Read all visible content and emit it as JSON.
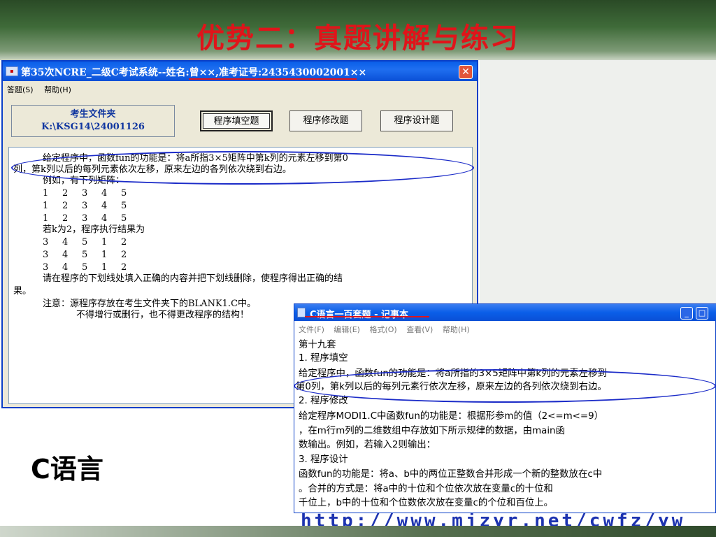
{
  "slide": {
    "title": "优势二：真题讲解与练习",
    "subject_label": "C语言",
    "footer_url": "http://www.mjzyr.net/cwfz/yw"
  },
  "exam_window": {
    "title": "第35次NCRE_二级C考试系统--姓名:曾××,准考证号:2435430002001××",
    "menu": [
      "答题(S)",
      "帮助(H)"
    ],
    "folder_label": "考生文件夹",
    "folder_path": "K:\\KSG14\\24001126",
    "tabs": [
      "程序填空题",
      "程序修改题",
      "程序设计题"
    ],
    "active_tab": "程序填空题",
    "content": {
      "line1": "给定程序中，函数fun的功能是：将a所指3×5矩阵中第k列的元素左移到第0",
      "line2": "列，第k列以后的每列元素依次左移，原来左边的各列依次绕到右边。",
      "line3": "例如，有下列矩阵：",
      "matrix_before": [
        [
          "1",
          "2",
          "3",
          "4",
          "5"
        ],
        [
          "1",
          "2",
          "3",
          "4",
          "5"
        ],
        [
          "1",
          "2",
          "3",
          "4",
          "5"
        ]
      ],
      "line4": "若k为2，程序执行结果为",
      "matrix_after": [
        [
          "3",
          "4",
          "5",
          "1",
          "2"
        ],
        [
          "3",
          "4",
          "5",
          "1",
          "2"
        ],
        [
          "3",
          "4",
          "5",
          "1",
          "2"
        ]
      ],
      "line5": "请在程序的下划线处填入正确的内容并把下划线删除，使程序得出正确的结",
      "line6": "果。",
      "line7": "注意：源程序存放在考生文件夹下的BLANK1.C中。",
      "line8": "不得增行或删行，也不得更改程序的结构！"
    }
  },
  "notepad": {
    "title": "C语言一百套题 - 记事本",
    "menu": [
      "文件(F)",
      "编辑(E)",
      "格式(O)",
      "查看(V)",
      "帮助(H)"
    ],
    "lines": [
      "第十九套",
      "1. 程序填空",
      "    给定程序中，函数fun的功能是：将a所指的3×5矩阵中第k列的元素左移到",
      "第0列，第k列以后的每列元素行依次左移，原来左边的各列依次绕到右边。",
      "2. 程序修改",
      "    给定程序MODI1.C中函数fun的功能是：根据形参m的值（2<=m<=9）",
      "，在m行m列的二维数组中存放如下所示规律的数据，由main函",
      "数输出。例如，若输入2则输出：",
      "3. 程序设计",
      "    函数fun的功能是：将a、b中的两位正整数合并形成一个新的整数放在c中",
      "。合并的方式是：将a中的十位和个位依次放在变量c的十位和",
      "千位上，b中的十位和个位数依次放在变量c的个位和百位上。"
    ]
  },
  "colors": {
    "title_red": "#e0141a",
    "annotation_blue": "#1b2bc8",
    "xp_blue": "#0a5ee8"
  }
}
